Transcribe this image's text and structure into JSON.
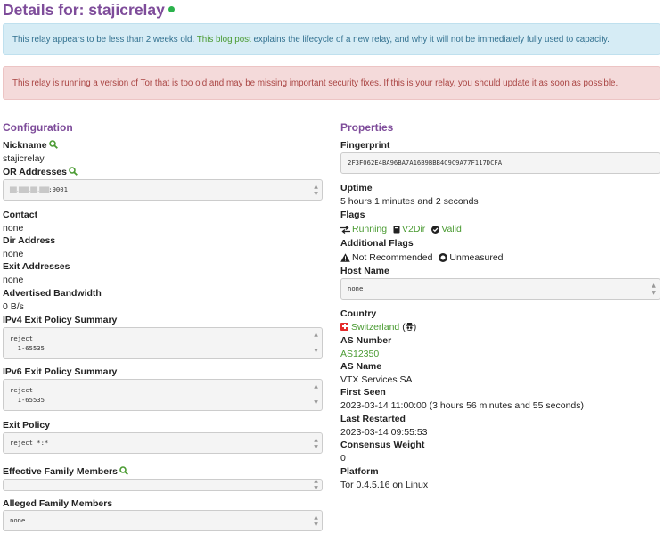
{
  "header": {
    "title": "Details for: stajicrelay"
  },
  "alerts": {
    "info_before": "This relay appears to be less than 2 weeks old. ",
    "info_link": "This blog post",
    "info_after": " explains the lifecycle of a new relay, and why it will not be immediately fully used to capacity.",
    "danger": "This relay is running a version of Tor that is too old and may be missing important security fixes. If this is your relay, you should update it as soon as possible."
  },
  "configuration": {
    "heading": "Configuration",
    "nickname_label": "Nickname",
    "nickname": "stajicrelay",
    "or_addresses_label": "OR Addresses",
    "or_address_masked": "▇▇.▇▇▇.▇▇.▇▇▇",
    "or_address_port": ":9001",
    "contact_label": "Contact",
    "contact": "none",
    "dir_address_label": "Dir Address",
    "dir_address": "none",
    "exit_addresses_label": "Exit Addresses",
    "exit_addresses": "none",
    "bandwidth_label": "Advertised Bandwidth",
    "bandwidth": "0 B/s",
    "ipv4_policy_label": "IPv4 Exit Policy Summary",
    "ipv4_policy": "reject\n  1-65535",
    "ipv6_policy_label": "IPv6 Exit Policy Summary",
    "ipv6_policy": "reject\n  1-65535",
    "exit_policy_label": "Exit Policy",
    "exit_policy": "reject *:*",
    "effective_family_label": "Effective Family Members",
    "effective_family": "",
    "alleged_family_label": "Alleged Family Members",
    "alleged_family": "none"
  },
  "properties": {
    "heading": "Properties",
    "fingerprint_label": "Fingerprint",
    "fingerprint": "2F3F062E4BA96BA7A16B9BBB4C9C9A77F117DCFA",
    "uptime_label": "Uptime",
    "uptime": "5 hours 1 minutes and 2 seconds",
    "flags_label": "Flags",
    "flags": [
      "Running",
      "V2Dir",
      "Valid"
    ],
    "additional_flags_label": "Additional Flags",
    "additional_flags": [
      "Not Recommended",
      "Unmeasured"
    ],
    "host_name_label": "Host Name",
    "host_name": "none",
    "country_label": "Country",
    "country": "Switzerland",
    "as_number_label": "AS Number",
    "as_number": "AS12350",
    "as_name_label": "AS Name",
    "as_name": "VTX Services SA",
    "first_seen_label": "First Seen",
    "first_seen": "2023-03-14 11:00:00 (3 hours 56 minutes and 55 seconds)",
    "last_restarted_label": "Last Restarted",
    "last_restarted": "2023-03-14 09:55:53",
    "consensus_weight_label": "Consensus Weight",
    "consensus_weight": "0",
    "platform_label": "Platform",
    "platform": "Tor 0.4.5.16 on Linux"
  },
  "colors": {
    "accent": "#7e4c9a",
    "link": "#4a9b32",
    "status": "#2bb24c"
  },
  "icons": [
    "search-icon",
    "running-arrows-icon",
    "v2dir-icon",
    "valid-check-icon",
    "warning-icon",
    "unmeasured-icon",
    "switzerland-flag-icon",
    "anonymous-icon"
  ]
}
